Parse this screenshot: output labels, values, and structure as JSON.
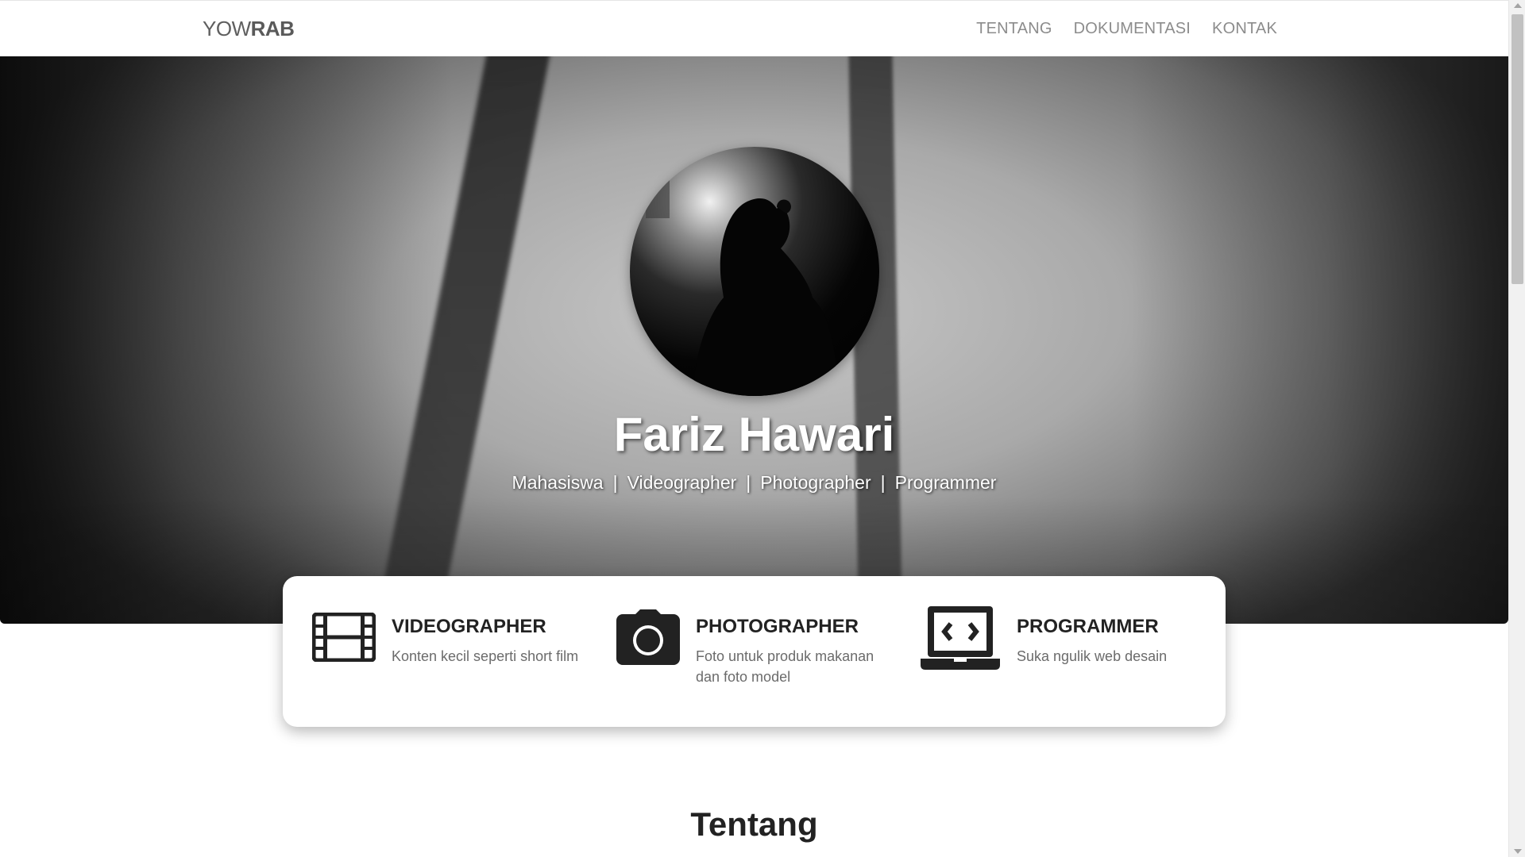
{
  "navbar": {
    "brand_light": "YOW",
    "brand_bold": "RAB",
    "links": [
      "TENTANG",
      "DOKUMENTASI",
      "KONTAK"
    ]
  },
  "hero": {
    "name": "Fariz Hawari",
    "roles": [
      "Mahasiswa",
      "Videographer",
      "Photographer",
      "Programmer"
    ],
    "separator": "|"
  },
  "features": [
    {
      "icon": "film-icon",
      "title": "VIDEOGRAPHER",
      "description": "Konten kecil seperti short film"
    },
    {
      "icon": "camera-icon",
      "title": "PHOTOGRAPHER",
      "description": "Foto untuk produk makanan dan foto model"
    },
    {
      "icon": "laptop-code-icon",
      "title": "PROGRAMMER",
      "description": "Suka ngulik web desain"
    }
  ],
  "section": {
    "title": "Tentang"
  },
  "colors": {
    "navbar_bg": "#ffffff",
    "nav_link": "#8c8c8c",
    "icon": "#222222",
    "text_muted": "#6b6b6b"
  }
}
